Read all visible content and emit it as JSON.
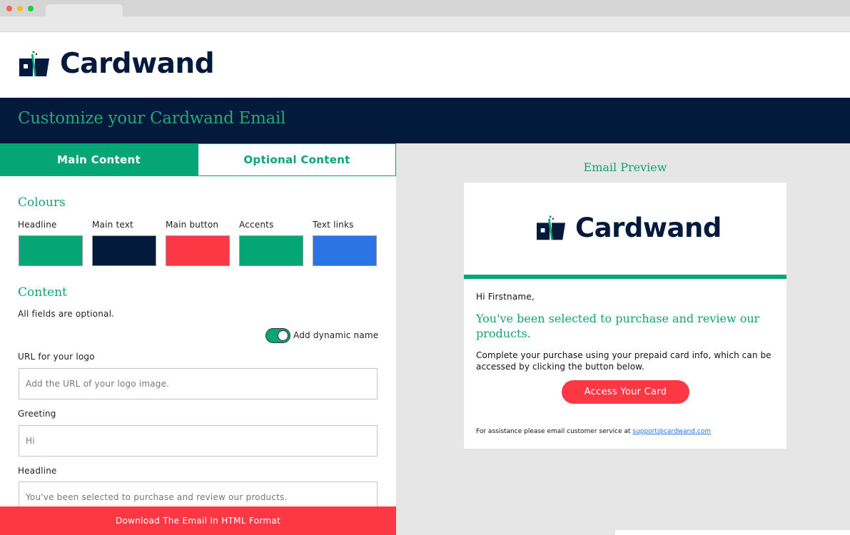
{
  "brand": {
    "name": "Cardwand"
  },
  "page_title": "Customize your Cardwand Email",
  "tabs": [
    {
      "label": "Main Content",
      "active": true
    },
    {
      "label": "Optional Content",
      "active": false
    }
  ],
  "colours": {
    "title": "Colours",
    "items": [
      {
        "label": "Headline",
        "color": "#05a676"
      },
      {
        "label": "Main text",
        "color": "#031a3d"
      },
      {
        "label": "Main button",
        "color": "#fc3845"
      },
      {
        "label": "Accents",
        "color": "#05a676"
      },
      {
        "label": "Text links",
        "color": "#2b74e6"
      }
    ]
  },
  "content": {
    "title": "Content",
    "note": "All fields are optional.",
    "toggle_label": "Add dynamic name",
    "toggle_on": true,
    "fields": [
      {
        "label": "URL for your logo",
        "placeholder": "Add the URL of your logo image."
      },
      {
        "label": "Greeting",
        "placeholder": "Hi"
      },
      {
        "label": "Headline",
        "placeholder": "You've been selected to purchase and review our products."
      }
    ]
  },
  "download_label": "Download The Email In HTML Format",
  "preview": {
    "title": "Email Preview",
    "greeting": "Hi Firstname,",
    "headline": "You've been selected to purchase and review our products.",
    "body": "Complete your purchase using your prepaid card info, which can be accessed by clicking the button below.",
    "button_label": "Access Your Card",
    "assist_text": "For assistance please email customer service at",
    "assist_link": "support@cardwand.com"
  }
}
